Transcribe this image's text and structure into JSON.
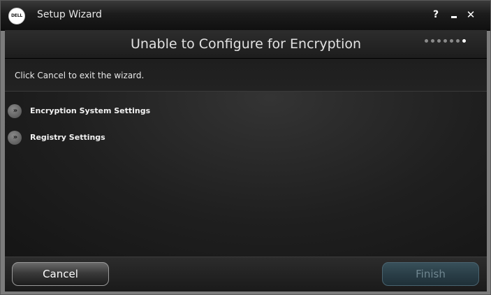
{
  "window": {
    "title": "Setup Wizard",
    "logo_text": "DELL",
    "help_glyph": "?",
    "minimize_icon": "minimize-icon",
    "close_glyph": "✕"
  },
  "header": {
    "title": "Unable to Configure for Encryption",
    "step_count": 7,
    "current_step": 7
  },
  "instruction": "Click Cancel to exit the wizard.",
  "items": [
    {
      "label": "Encryption System Settings",
      "icon": "double-chevron-right-icon"
    },
    {
      "label": "Registry Settings",
      "icon": "double-chevron-right-icon"
    }
  ],
  "buttons": {
    "cancel": "Cancel",
    "finish": "Finish"
  },
  "colors": {
    "background": "#1b1b1b",
    "finish_disabled": "#2a3e47"
  }
}
